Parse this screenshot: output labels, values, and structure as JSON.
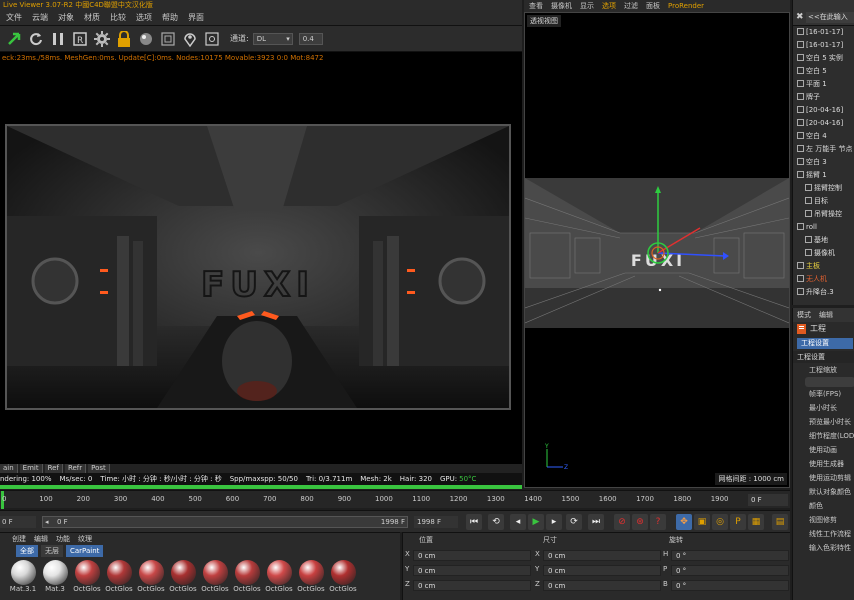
{
  "live_viewer": {
    "title": "Live Viewer 3.07-R2 中國C4D聯盟中文汉化版",
    "menu": [
      "文件",
      "云端",
      "对象",
      "材质",
      "比较",
      "选项",
      "帮助",
      "界面"
    ],
    "channel_label": "通道:",
    "channel_value": "DL",
    "depth_value": "0.4",
    "stats": "eck:23ms./58ms. MeshGen:0ms. Update[C]:0ms. Nodes:10175 Movable:3923  0:0 Mot:8472",
    "render_text": "FUXI",
    "bottom_tabs": [
      "ain",
      "Emit",
      "Ref",
      "Refr",
      "Post"
    ],
    "status": {
      "rendering": "ndering: 100%",
      "ms": "Ms/sec: 0",
      "time": "Time: 小时 : 分钟 : 秒/小时 : 分钟 : 秒",
      "spp": "Spp/maxspp: 50/50",
      "tri": "Tri: 0/3.711m",
      "mesh": "Mesh: 2k",
      "hair": "Hair: 320",
      "gpu": "GPU:",
      "temp": "50°C"
    },
    "progress": 1.0
  },
  "viewport": {
    "menu": [
      "查看",
      "摄像机",
      "显示",
      "选项",
      "过滤",
      "面板",
      "ProRender"
    ],
    "active_menu": "选项",
    "label": "透视视图",
    "grid_distance": "网格间距 : 1000 cm",
    "scene_text": "FUXI"
  },
  "object_manager": {
    "search": "<<在此输入",
    "items": [
      {
        "label": "[16-01-17]",
        "style": "normal"
      },
      {
        "label": "[16-01-17]",
        "style": "normal"
      },
      {
        "label": "空白 5 实例",
        "style": "normal"
      },
      {
        "label": "空白 5",
        "style": "normal"
      },
      {
        "label": "平面 1",
        "style": "normal"
      },
      {
        "label": "牌子",
        "style": "normal"
      },
      {
        "label": "[20-04-16]",
        "style": "normal"
      },
      {
        "label": "[20-04-16]",
        "style": "normal"
      },
      {
        "label": "空白 4",
        "style": "normal"
      },
      {
        "label": "左 万能手 节点",
        "style": "normal"
      },
      {
        "label": "空白 3",
        "style": "normal"
      },
      {
        "label": "摇臂 1",
        "style": "normal"
      },
      {
        "label": "摇臂控制",
        "style": "normal"
      },
      {
        "label": "目标",
        "style": "normal"
      },
      {
        "label": "吊臂操控",
        "style": "normal"
      },
      {
        "label": "roll",
        "style": "normal"
      },
      {
        "label": "基地",
        "style": "normal"
      },
      {
        "label": "摄像机",
        "style": "normal"
      },
      {
        "label": "主板",
        "style": "hl"
      },
      {
        "label": "无人机",
        "style": "red"
      },
      {
        "label": "升降台.3",
        "style": "normal"
      }
    ]
  },
  "attribute_manager": {
    "tabs": [
      "模式",
      "编辑"
    ],
    "object_label": "工程",
    "settings_tab": "工程设置",
    "section": "工程设置",
    "rows": [
      "工程缩放",
      "帧率(FPS)",
      "最小时长",
      "预览最小时长",
      "细节程度(LOD)",
      "使用动画",
      "使用生成器",
      "使用运动剪辑",
      "默认对象颜色",
      "颜色",
      "视图修剪",
      "线性工作流程",
      "输入色彩特性"
    ]
  },
  "timeline": {
    "ticks": [
      "0",
      "100",
      "200",
      "300",
      "400",
      "500",
      "600",
      "700",
      "800",
      "900",
      "1000",
      "1100",
      "1200",
      "1300",
      "1400",
      "1500",
      "1600",
      "1700",
      "1800",
      "1900",
      "200"
    ],
    "current_frame": "0 F",
    "start_field": "0 F",
    "range_start": "0 F",
    "range_end": "1998 F",
    "end_field": "1998 F"
  },
  "material_manager": {
    "menu": [
      "创建",
      "编辑",
      "功能",
      "纹理"
    ],
    "filters": [
      "全部",
      "无层",
      "CarPaint"
    ],
    "materials": [
      {
        "label": "Mat.3.1",
        "color": "#d8d8d8"
      },
      {
        "label": "Mat.3",
        "color": "#e4e4e4"
      },
      {
        "label": "OctGlos",
        "color": "#c04040"
      },
      {
        "label": "OctGlos",
        "color": "#b03838"
      },
      {
        "label": "OctGlos",
        "color": "#c84848"
      },
      {
        "label": "OctGlos",
        "color": "#a83030"
      },
      {
        "label": "OctGlos",
        "color": "#c04040"
      },
      {
        "label": "OctGlos",
        "color": "#b83c3c"
      },
      {
        "label": "OctGlos",
        "color": "#d04a4a"
      },
      {
        "label": "OctGlos",
        "color": "#c84040"
      },
      {
        "label": "OctGlos",
        "color": "#b03030"
      }
    ]
  },
  "coordinates": {
    "headers": {
      "position": "位置",
      "size": "尺寸",
      "rotation": "旋转"
    },
    "rows": [
      {
        "axis": "X",
        "position": "0 cm",
        "size_axis": "X",
        "size": "0 cm",
        "rot_axis": "H",
        "rotation": "0 °"
      },
      {
        "axis": "Y",
        "position": "0 cm",
        "size_axis": "Y",
        "size": "0 cm",
        "rot_axis": "P",
        "rotation": "0 °"
      },
      {
        "axis": "Z",
        "position": "0 cm",
        "size_axis": "Z",
        "size": "0 cm",
        "rot_axis": "B",
        "rotation": "0 °"
      }
    ]
  },
  "colors": {
    "accent_orange": "#e0a000",
    "progress_green": "#39c43f",
    "selection_blue": "#3d6aa8"
  }
}
